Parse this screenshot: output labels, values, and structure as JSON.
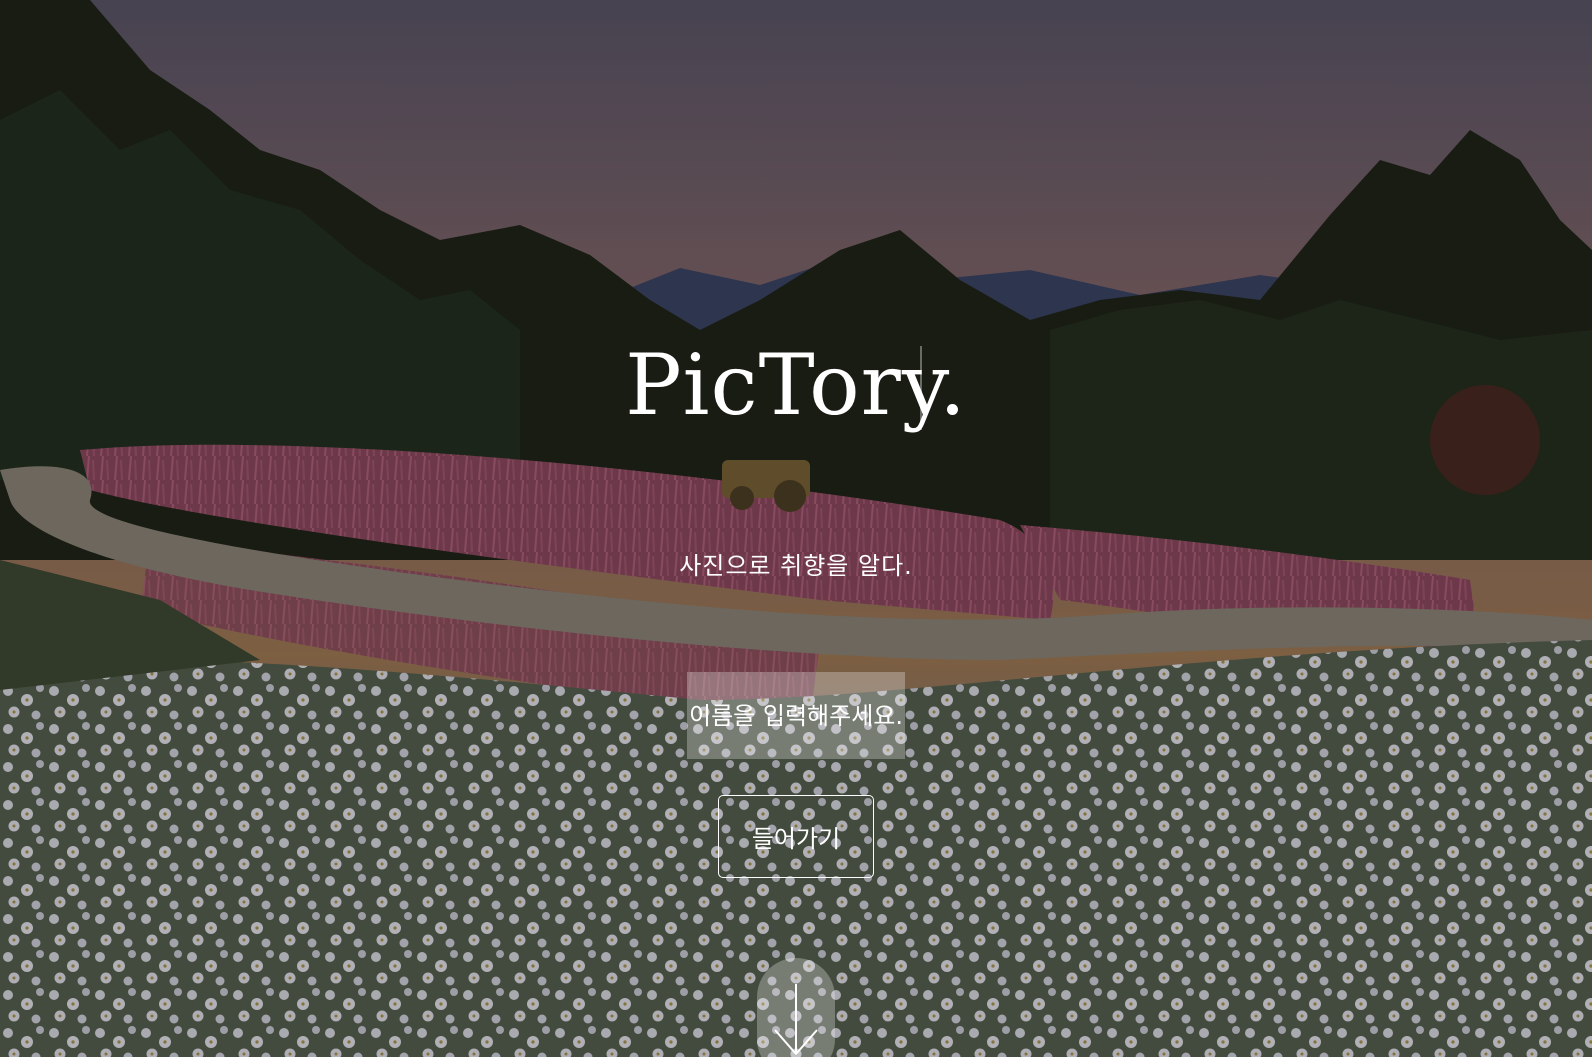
{
  "hero": {
    "logo": "PicTory.",
    "tagline": "사진으로 취향을 알다.",
    "name_input": {
      "placeholder": "이름을 입력해주세요.",
      "value": ""
    },
    "enter_button_label": "들어가기",
    "scroll_icon": "arrow-down-icon"
  },
  "colors": {
    "text": "#ffffff",
    "overlay": "rgba(0,0,0,0.22)",
    "input_background": "rgba(255,255,255,0.28)"
  }
}
